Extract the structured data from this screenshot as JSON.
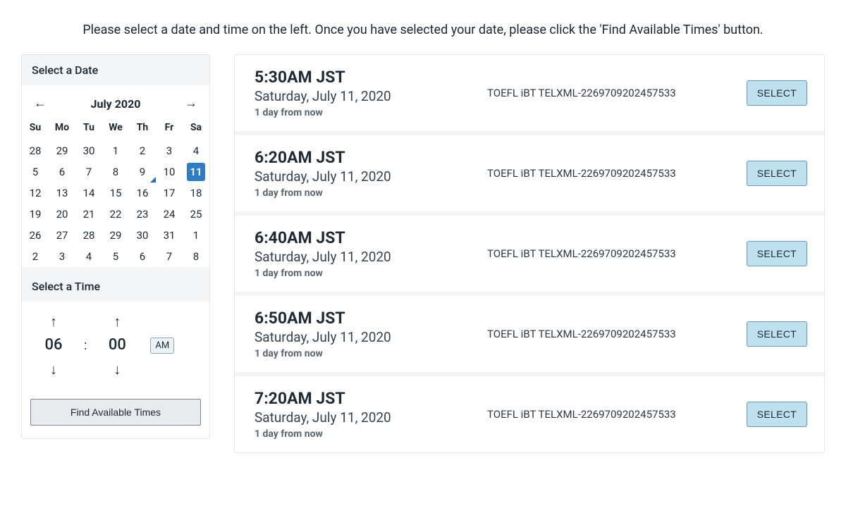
{
  "instruction": "Please select a date and time on the left. Once you have selected your date, please click the 'Find Available Times' button.",
  "datePanel": {
    "header": "Select a Date",
    "monthLabel": "July 2020",
    "dow": [
      "Su",
      "Mo",
      "Tu",
      "We",
      "Th",
      "Fr",
      "Sa"
    ],
    "weeks": [
      [
        {
          "d": "28",
          "cls": "other-month"
        },
        {
          "d": "29",
          "cls": "other-month"
        },
        {
          "d": "30",
          "cls": "other-month"
        },
        {
          "d": "1",
          "cls": ""
        },
        {
          "d": "2",
          "cls": ""
        },
        {
          "d": "3",
          "cls": ""
        },
        {
          "d": "4",
          "cls": ""
        }
      ],
      [
        {
          "d": "5",
          "cls": ""
        },
        {
          "d": "6",
          "cls": ""
        },
        {
          "d": "7",
          "cls": ""
        },
        {
          "d": "8",
          "cls": ""
        },
        {
          "d": "9",
          "cls": "marked"
        },
        {
          "d": "10",
          "cls": ""
        },
        {
          "d": "11",
          "cls": "selected-day"
        }
      ],
      [
        {
          "d": "12",
          "cls": ""
        },
        {
          "d": "13",
          "cls": ""
        },
        {
          "d": "14",
          "cls": ""
        },
        {
          "d": "15",
          "cls": ""
        },
        {
          "d": "16",
          "cls": ""
        },
        {
          "d": "17",
          "cls": ""
        },
        {
          "d": "18",
          "cls": ""
        }
      ],
      [
        {
          "d": "19",
          "cls": ""
        },
        {
          "d": "20",
          "cls": ""
        },
        {
          "d": "21",
          "cls": ""
        },
        {
          "d": "22",
          "cls": ""
        },
        {
          "d": "23",
          "cls": ""
        },
        {
          "d": "24",
          "cls": ""
        },
        {
          "d": "25",
          "cls": ""
        }
      ],
      [
        {
          "d": "26",
          "cls": ""
        },
        {
          "d": "27",
          "cls": ""
        },
        {
          "d": "28",
          "cls": ""
        },
        {
          "d": "29",
          "cls": ""
        },
        {
          "d": "30",
          "cls": ""
        },
        {
          "d": "31",
          "cls": ""
        },
        {
          "d": "1",
          "cls": "other-month"
        }
      ],
      [
        {
          "d": "2",
          "cls": "other-month"
        },
        {
          "d": "3",
          "cls": "other-month"
        },
        {
          "d": "4",
          "cls": "other-month"
        },
        {
          "d": "5",
          "cls": "other-month"
        },
        {
          "d": "6",
          "cls": "other-month"
        },
        {
          "d": "7",
          "cls": "other-month"
        },
        {
          "d": "8",
          "cls": "other-month"
        }
      ]
    ]
  },
  "timePanel": {
    "header": "Select a Time",
    "hour": "06",
    "minute": "00",
    "ampm": "AM"
  },
  "findButton": "Find Available Times",
  "selectLabel": "SELECT",
  "slots": [
    {
      "time": "5:30AM JST",
      "date": "Saturday, July 11, 2020",
      "rel": "1 day from now",
      "desc": "TOEFL iBT TELXML-2269709202457533"
    },
    {
      "time": "6:20AM JST",
      "date": "Saturday, July 11, 2020",
      "rel": "1 day from now",
      "desc": "TOEFL iBT TELXML-2269709202457533"
    },
    {
      "time": "6:40AM JST",
      "date": "Saturday, July 11, 2020",
      "rel": "1 day from now",
      "desc": "TOEFL iBT TELXML-2269709202457533"
    },
    {
      "time": "6:50AM JST",
      "date": "Saturday, July 11, 2020",
      "rel": "1 day from now",
      "desc": "TOEFL iBT TELXML-2269709202457533"
    },
    {
      "time": "7:20AM JST",
      "date": "Saturday, July 11, 2020",
      "rel": "1 day from now",
      "desc": "TOEFL iBT TELXML-2269709202457533"
    }
  ]
}
